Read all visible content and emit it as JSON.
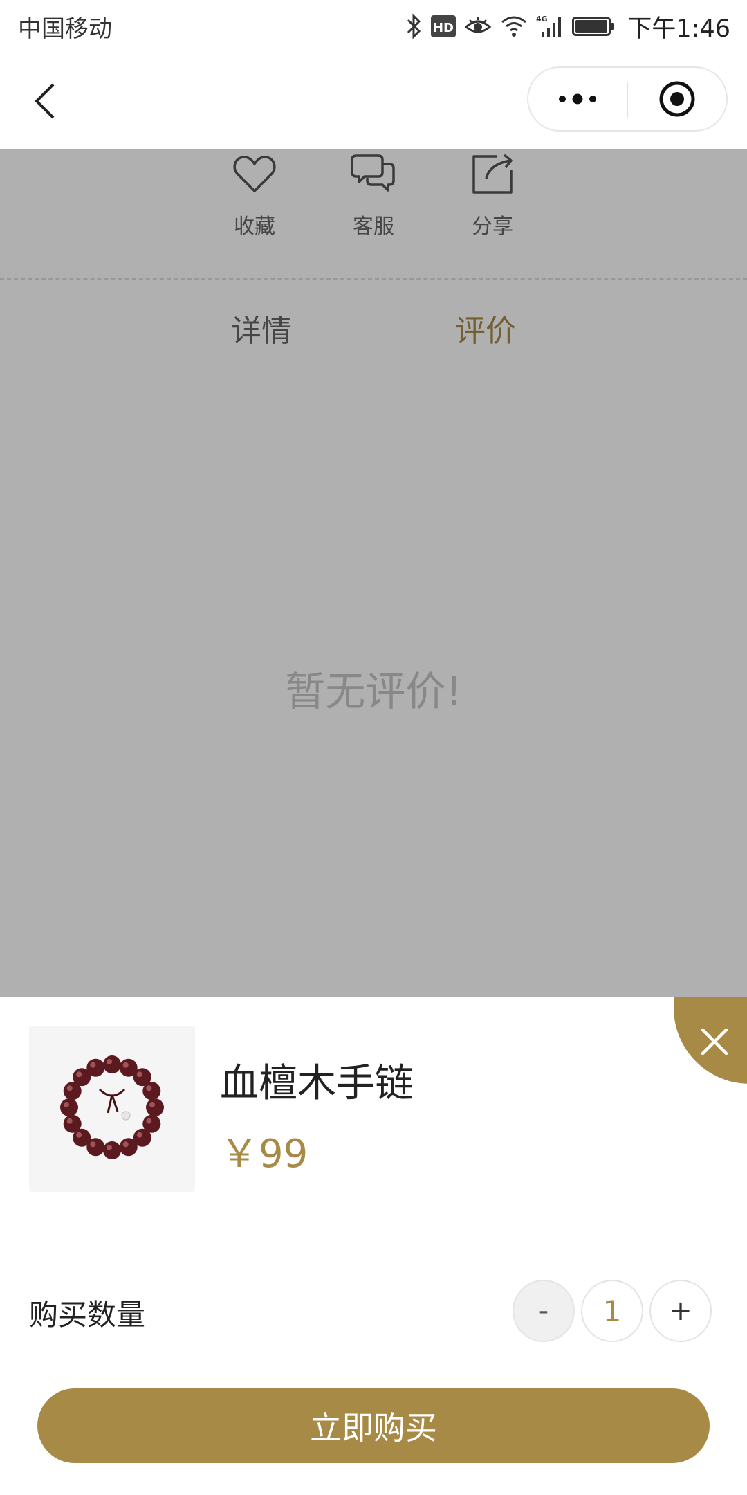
{
  "status_bar": {
    "carrier": "中国移动",
    "network": "4G",
    "hd": "HD",
    "time": "下午1:46"
  },
  "nav": {
    "back_icon": "chevron-left-icon",
    "more_icon": "more-dots-icon",
    "target_icon": "target-icon"
  },
  "actions": [
    {
      "label": "收藏",
      "icon": "heart-icon"
    },
    {
      "label": "客服",
      "icon": "chat-icon"
    },
    {
      "label": "分享",
      "icon": "share-icon"
    }
  ],
  "tabs": [
    {
      "label": "详情",
      "active": false
    },
    {
      "label": "评价",
      "active": true
    }
  ],
  "reviews": {
    "empty_text": "暂无评价!"
  },
  "sheet": {
    "close_icon": "close-icon",
    "product_name": "血檀木手链",
    "price": "￥99",
    "quantity_label": "购买数量",
    "decrement": "-",
    "quantity": "1",
    "increment": "+",
    "buy_label": "立即购买"
  },
  "colors": {
    "accent": "#a88a47",
    "overlay": "#b0b0b0"
  }
}
